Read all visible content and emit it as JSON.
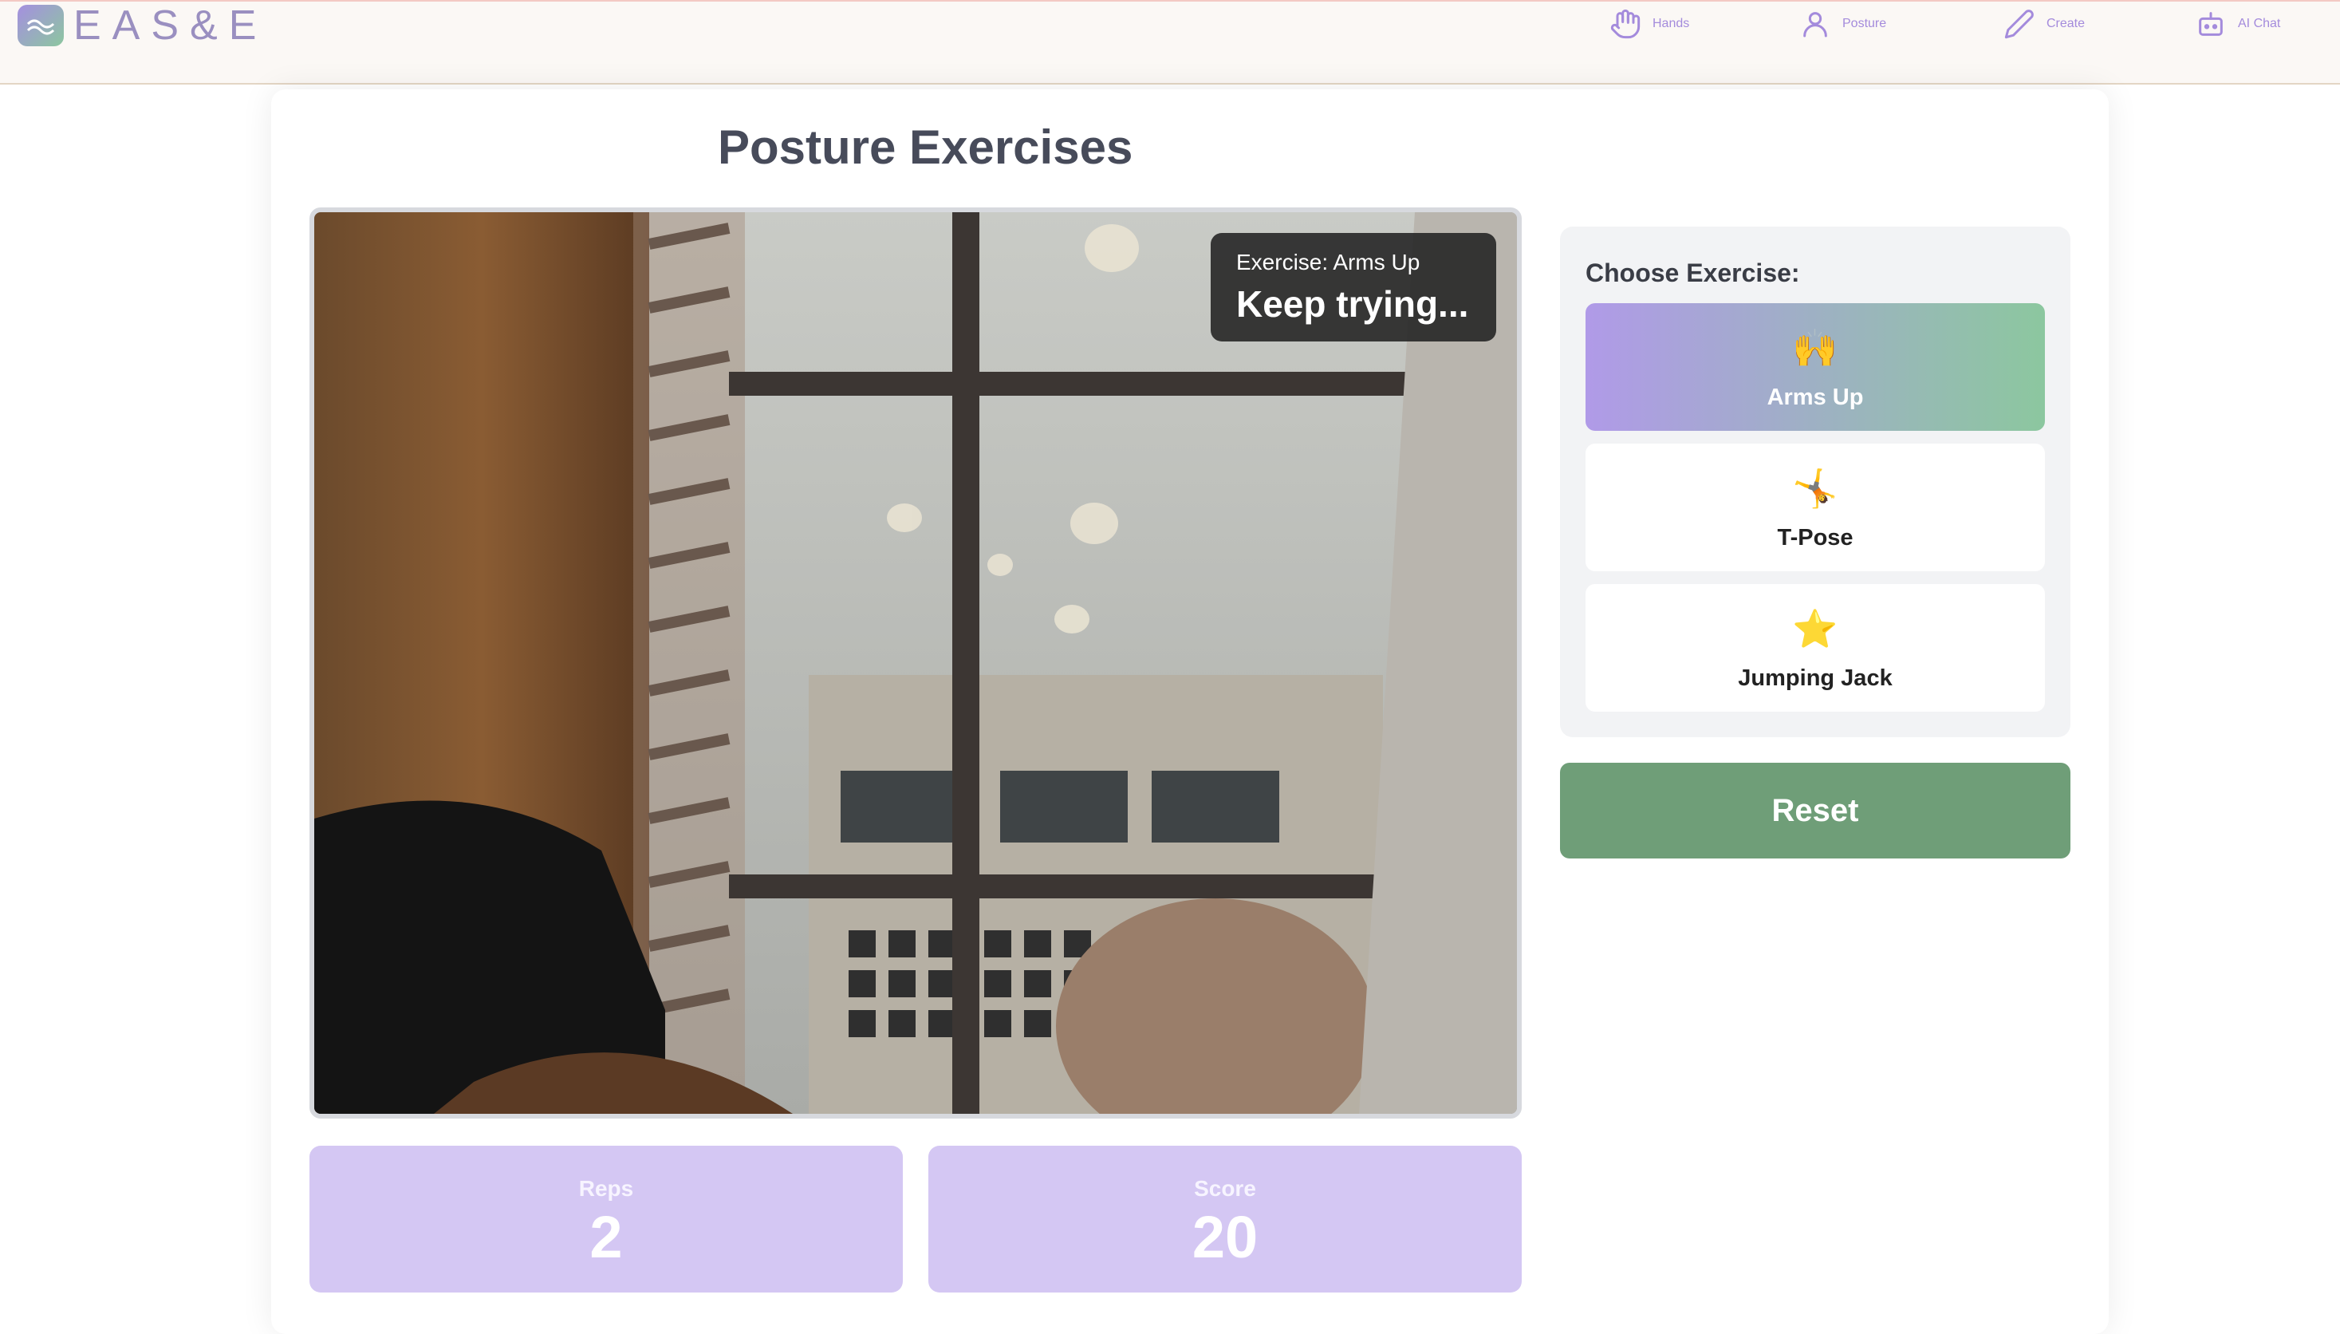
{
  "app": {
    "logo_text": "EAS&E"
  },
  "nav": {
    "items": [
      {
        "label": "Hands",
        "icon": "hand-icon"
      },
      {
        "label": "Posture",
        "icon": "person-icon"
      },
      {
        "label": "Create",
        "icon": "pencil-icon"
      },
      {
        "label": "AI Chat",
        "icon": "robot-icon"
      }
    ]
  },
  "page": {
    "title": "Posture Exercises"
  },
  "video": {
    "overlay_label": "Exercise: Arms Up",
    "overlay_status": "Keep trying..."
  },
  "exercise_panel": {
    "title": "Choose Exercise:",
    "options": [
      {
        "icon": "🙌",
        "label": "Arms Up",
        "active": true
      },
      {
        "icon": "🤸",
        "label": "T-Pose",
        "active": false
      },
      {
        "icon": "⭐",
        "label": "Jumping Jack",
        "active": false
      }
    ],
    "reset_label": "Reset"
  },
  "stats": {
    "reps_label": "Reps",
    "reps_value": "2",
    "score_label": "Score",
    "score_value": "20"
  },
  "colors": {
    "accent_purple": "#a48bdc",
    "accent_green": "#6f9e78",
    "stat_bg": "#d4c7f3"
  }
}
